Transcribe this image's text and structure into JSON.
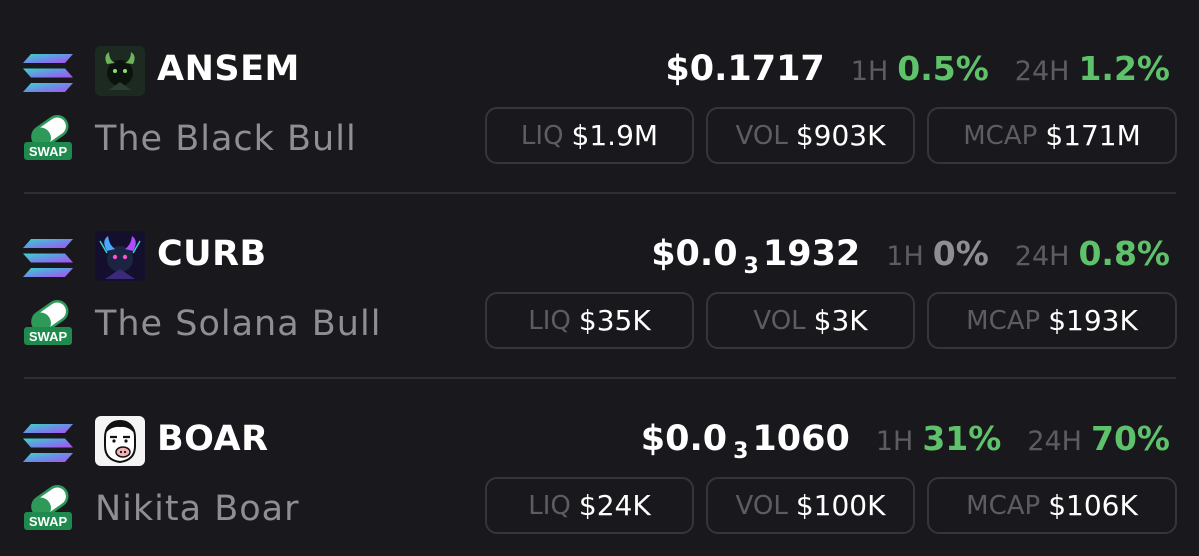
{
  "colors": {
    "background": "#19191d",
    "positive": "#5ec26a",
    "neutral": "#8e8e94",
    "muted_label": "#5c5c62",
    "pill_border": "#35353b"
  },
  "tokens": [
    {
      "symbol": "ANSEM",
      "name": "The Black Bull",
      "chain_icon": "solana-icon",
      "swap_icon": "swap-pill-icon",
      "avatar_icon": "black-bull-avatar",
      "price": {
        "prefix": "$0.1717",
        "subscript": "",
        "digits": ""
      },
      "h1_label": "1H",
      "h1_change": "0.5%",
      "h1_color": "#5ec26a",
      "h24_label": "24H",
      "h24_change": "1.2%",
      "h24_color": "#5ec26a",
      "liq_label": "LIQ",
      "liq_value": "$1.9M",
      "vol_label": "VOL",
      "vol_value": "$903K",
      "mcap_label": "MCAP",
      "mcap_value": "$171M"
    },
    {
      "symbol": "CURB",
      "name": "The Solana Bull",
      "chain_icon": "solana-icon",
      "swap_icon": "swap-pill-icon",
      "avatar_icon": "solana-bull-avatar",
      "price": {
        "prefix": "$0.0",
        "subscript": "3",
        "digits": "1932"
      },
      "h1_label": "1H",
      "h1_change": "0%",
      "h1_color": "#8e8e94",
      "h24_label": "24H",
      "h24_change": "0.8%",
      "h24_color": "#5ec26a",
      "liq_label": "LIQ",
      "liq_value": "$35K",
      "vol_label": "VOL",
      "vol_value": "$3K",
      "mcap_label": "MCAP",
      "mcap_value": "$193K"
    },
    {
      "symbol": "BOAR",
      "name": "Nikita Boar",
      "chain_icon": "solana-icon",
      "swap_icon": "swap-pill-icon",
      "avatar_icon": "boar-face-avatar",
      "price": {
        "prefix": "$0.0",
        "subscript": "3",
        "digits": "1060"
      },
      "h1_label": "1H",
      "h1_change": "31%",
      "h1_color": "#5ec26a",
      "h24_label": "24H",
      "h24_change": "70%",
      "h24_color": "#5ec26a",
      "liq_label": "LIQ",
      "liq_value": "$24K",
      "vol_label": "VOL",
      "vol_value": "$100K",
      "mcap_label": "MCAP",
      "mcap_value": "$106K"
    }
  ]
}
